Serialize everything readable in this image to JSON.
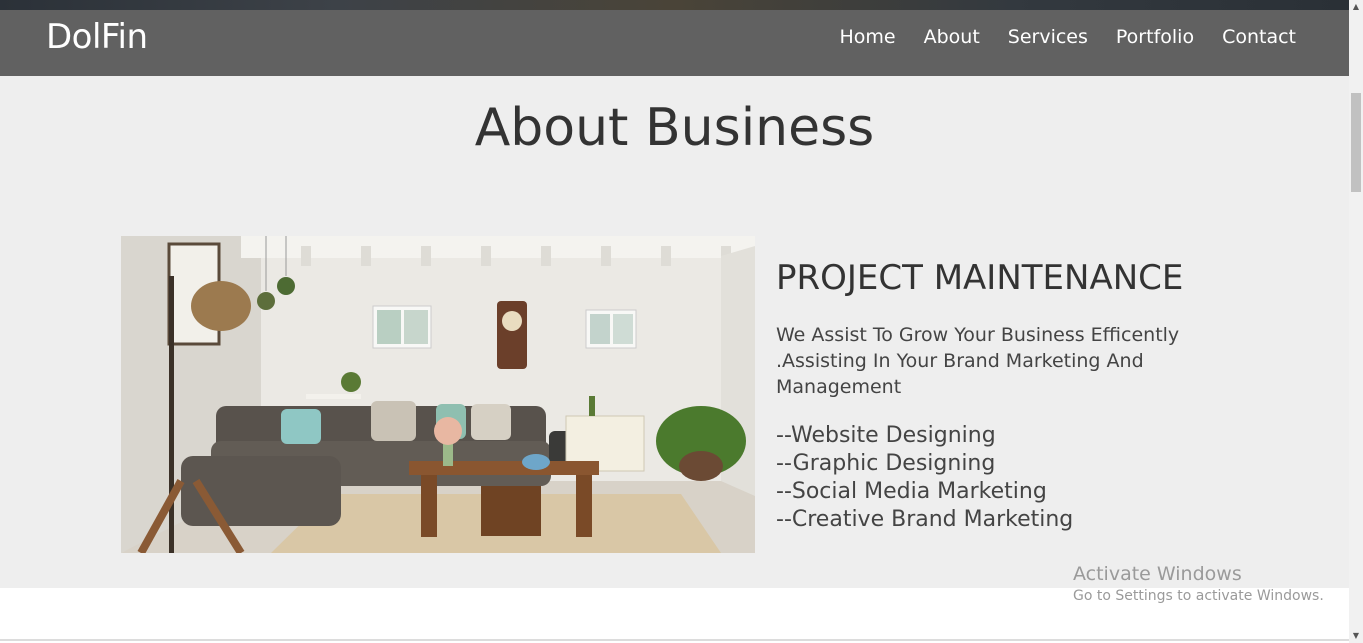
{
  "header": {
    "brand": "DolFin",
    "nav": [
      "Home",
      "About",
      "Services",
      "Portfolio",
      "Contact"
    ]
  },
  "about": {
    "title": "About Business",
    "heading": "PROJECT MAINTENANCE",
    "description": "We Assist To Grow Your Business Efficently .Assisting In Your Brand Marketing And Management",
    "services": [
      "--Website Designing",
      "--Graphic Designing",
      "--Social Media Marketing",
      "--Creative Brand Marketing"
    ]
  },
  "watermark": {
    "title": "Activate Windows",
    "subtitle": "Go to Settings to activate Windows."
  },
  "colors": {
    "navbar": "#616161",
    "section_bg": "#eeeeee",
    "text": "#333333"
  }
}
